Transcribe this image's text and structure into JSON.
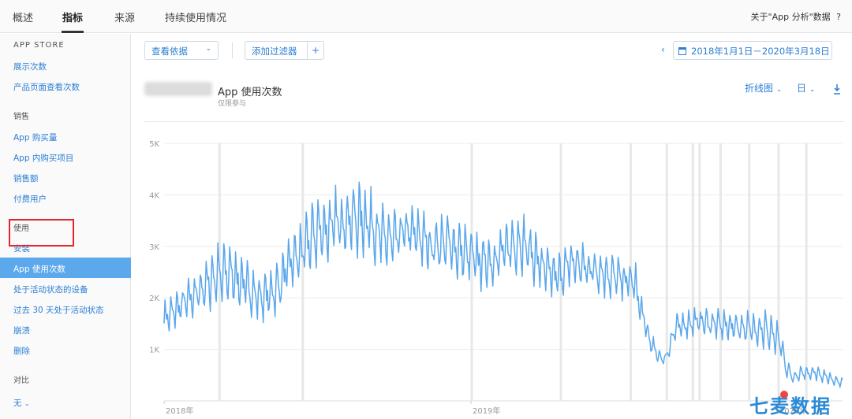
{
  "topnav": {
    "tabs": [
      "概述",
      "指标",
      "来源",
      "持续使用情况"
    ],
    "active_tab": "指标",
    "about": "关于\"App 分析\"数据",
    "help": "?"
  },
  "sidebar": {
    "section_appstore": "APP STORE",
    "appstore_items": [
      "展示次数",
      "产品页面查看次数"
    ],
    "section_sales": "销售",
    "sales_items": [
      "App 购买量",
      "App 内购买项目",
      "销售额",
      "付费用户"
    ],
    "section_usage": "使用",
    "usage_items": [
      "安装",
      "App 使用次数",
      "处于活动状态的设备",
      "过去 30 天处于活动状态",
      "崩溃",
      "删除"
    ],
    "active_item": "App 使用次数",
    "section_compare": "对比",
    "compare_value": "无"
  },
  "toolbar": {
    "view_by": "查看依据",
    "add_filter": "添加过滤器",
    "plus": "+",
    "prev_symbol": "‹",
    "date_range": "2018年1月1日－2020年3月18日"
  },
  "chart_header": {
    "title": "App 使用次数",
    "subtitle": "仅限参与",
    "chart_type": "折线图",
    "granularity": "日"
  },
  "colors": {
    "accent": "#2a7fd4",
    "line": "#5ba7ea",
    "active_sidebar": "#5ca8ec",
    "highlight": "#e2262d",
    "event_bar": "#e8e8e8",
    "watermark": "#2a8ad6"
  },
  "chart_data": {
    "type": "line",
    "title": "App 使用次数",
    "xlabel": "",
    "ylabel": "",
    "x_range": [
      "2018-01-01",
      "2020-03-18"
    ],
    "ylim": [
      0,
      5000
    ],
    "yticks": [
      1000,
      2000,
      3000,
      4000,
      5000
    ],
    "ytick_labels": [
      "1K",
      "2K",
      "3K",
      "4K",
      "5K"
    ],
    "xtick_labels": [
      "2018年",
      "2019年",
      "2020年"
    ],
    "xtick_dates": [
      "2018-01-01",
      "2019-01-01",
      "2020-01-01"
    ],
    "grid": true,
    "event_markers": [
      "2018-03-08",
      "2018-06-15",
      "2019-01-02",
      "2019-04-18",
      "2019-07-10",
      "2019-08-22",
      "2019-09-22",
      "2019-09-30",
      "2019-10-25",
      "2019-11-28",
      "2020-01-02",
      "2020-02-04"
    ],
    "series": [
      {
        "name": "",
        "smooth_dates": [
          "2018-01-01",
          "2018-01-10",
          "2018-01-25",
          "2018-02-10",
          "2018-03-01",
          "2018-03-20",
          "2018-04-10",
          "2018-04-25",
          "2018-05-10",
          "2018-05-20",
          "2018-06-01",
          "2018-06-15",
          "2018-07-01",
          "2018-07-15",
          "2018-08-01",
          "2018-08-15",
          "2018-09-01",
          "2018-09-15",
          "2018-10-01",
          "2018-10-15",
          "2018-11-01",
          "2018-11-15",
          "2018-12-01",
          "2018-12-20",
          "2019-01-01",
          "2019-01-15",
          "2019-02-01",
          "2019-02-15",
          "2019-03-01",
          "2019-03-15",
          "2019-04-01",
          "2019-04-15",
          "2019-05-01",
          "2019-05-15",
          "2019-06-01",
          "2019-06-15",
          "2019-07-01",
          "2019-07-15",
          "2019-07-20",
          "2019-08-01",
          "2019-08-10",
          "2019-08-20",
          "2019-09-01",
          "2019-09-15",
          "2019-10-01",
          "2019-10-15",
          "2019-11-01",
          "2019-11-15",
          "2019-12-01",
          "2019-12-15",
          "2019-12-25",
          "2020-01-05",
          "2020-01-10",
          "2020-01-20",
          "2020-02-01",
          "2020-02-15",
          "2020-03-01",
          "2020-03-18"
        ],
        "smooth_values": [
          1600,
          1700,
          1900,
          2100,
          2400,
          2500,
          2200,
          2000,
          2100,
          2300,
          2700,
          2900,
          3300,
          3350,
          3500,
          3550,
          3500,
          3200,
          3100,
          3300,
          3200,
          3000,
          3100,
          2900,
          2800,
          2700,
          2750,
          3000,
          3100,
          2850,
          2500,
          2400,
          2700,
          2600,
          2550,
          2450,
          2350,
          2300,
          1900,
          1200,
          900,
          800,
          1400,
          1500,
          1550,
          1500,
          1450,
          1450,
          1400,
          1400,
          1300,
          1100,
          650,
          450,
          550,
          550,
          450,
          350
        ],
        "weekly_amplitude": [
          0.13,
          0.17,
          0.15,
          0.14,
          0.13,
          0.12,
          0.11,
          0.13,
          0.12,
          0.12,
          0.1,
          0.12,
          0.12,
          0.12,
          0.15,
          0.2,
          0.18
        ]
      }
    ]
  }
}
